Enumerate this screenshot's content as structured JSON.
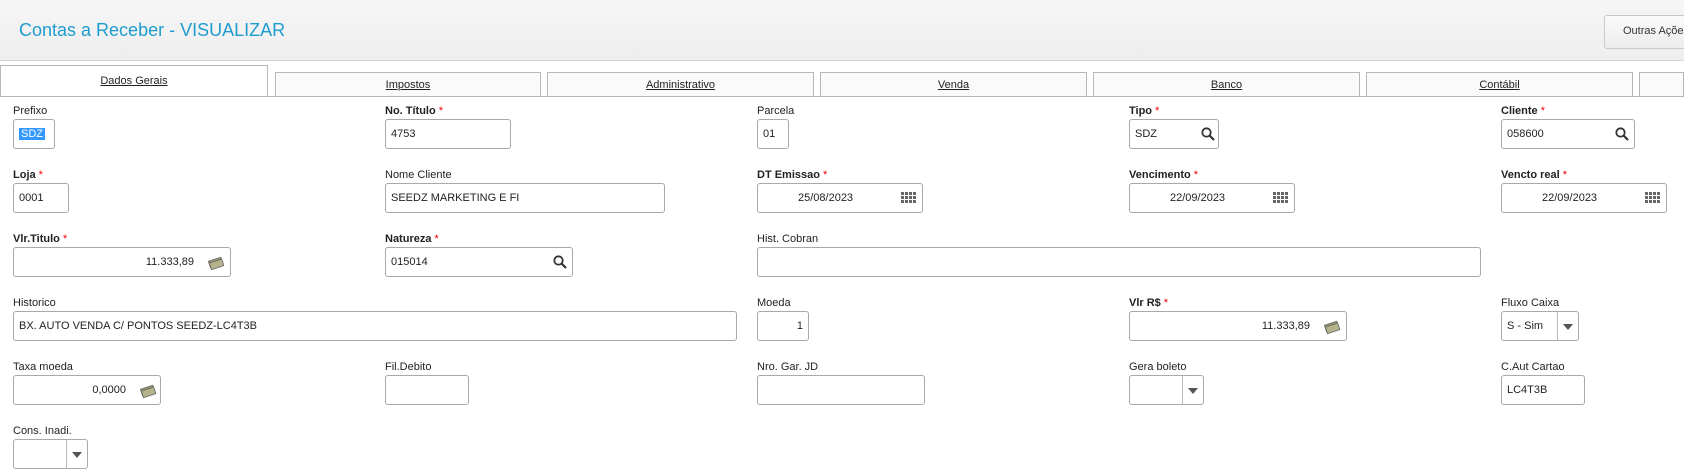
{
  "header": {
    "title": "Contas a Receber - VISUALIZAR",
    "more_actions": "Outras Ações"
  },
  "tabs": [
    {
      "label": "Dados Gerais",
      "active": true
    },
    {
      "label": "Impostos"
    },
    {
      "label": "Administrativo"
    },
    {
      "label": "Venda"
    },
    {
      "label": "Banco"
    },
    {
      "label": "Contábil"
    }
  ],
  "fields": {
    "prefixo": {
      "label": "Prefixo",
      "value": "SDZ"
    },
    "no_titulo": {
      "label": "No. Título",
      "value": "4753",
      "required": "*"
    },
    "parcela": {
      "label": "Parcela",
      "value": "01"
    },
    "tipo": {
      "label": "Tipo",
      "value": "SDZ",
      "required": "*"
    },
    "cliente": {
      "label": "Cliente",
      "value": "058600",
      "required": "*"
    },
    "loja": {
      "label": "Loja",
      "value": "0001",
      "required": "*"
    },
    "nome_cliente": {
      "label": "Nome Cliente",
      "value": "SEEDZ MARKETING E FI"
    },
    "dt_emissao": {
      "label": "DT Emissao",
      "value": "25/08/2023",
      "required": "*"
    },
    "vencimento": {
      "label": "Vencimento",
      "value": "22/09/2023",
      "required": "*"
    },
    "vencto_real": {
      "label": "Vencto real",
      "value": "22/09/2023",
      "required": "*"
    },
    "vlr_titulo": {
      "label": "Vlr.Titulo",
      "value": "11.333,89",
      "required": "*"
    },
    "natureza": {
      "label": "Natureza",
      "value": "015014",
      "required": "*"
    },
    "hist_cobran": {
      "label": "Hist. Cobran",
      "value": ""
    },
    "historico": {
      "label": "Historico",
      "value": "BX. AUTO VENDA C/ PONTOS SEEDZ-LC4T3B"
    },
    "moeda": {
      "label": "Moeda",
      "value": "1"
    },
    "vlr_rs": {
      "label": "Vlr R$",
      "value": "11.333,89",
      "required": "*"
    },
    "fluxo_caixa": {
      "label": "Fluxo Caixa",
      "value": "S - Sim"
    },
    "taxa_moeda": {
      "label": "Taxa moeda",
      "value": "0,0000"
    },
    "fil_debito": {
      "label": "Fil.Debito",
      "value": ""
    },
    "nro_gar_jd": {
      "label": "Nro. Gar. JD",
      "value": ""
    },
    "gera_boleto": {
      "label": "Gera boleto",
      "value": ""
    },
    "c_aut_cartao": {
      "label": "C.Aut Cartao",
      "value": "LC4T3B"
    },
    "cons_inadi": {
      "label": "Cons. Inadi.",
      "value": ""
    }
  },
  "icons": {
    "lookup": "search-icon",
    "date": "calendar-icon",
    "money": "money-icon",
    "dropdown": "chevron-down-icon"
  },
  "colors": {
    "title": "#1f9ccf",
    "required": "#e00000",
    "selection": "#3399ff"
  }
}
